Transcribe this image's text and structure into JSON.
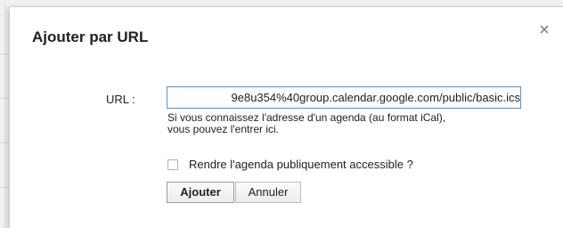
{
  "dialog": {
    "title": "Ajouter par URL",
    "close_icon": "close-icon"
  },
  "url_field": {
    "label": "URL :",
    "value": "9e8u354%40group.calendar.google.com/public/basic.ics"
  },
  "hint": {
    "line1": "Si vous connaissez l'adresse d'un agenda (au format iCal),",
    "line2": "vous pouvez l'entrer ici."
  },
  "public_option": {
    "label": "Rendre l'agenda publiquement accessible ?",
    "checked": false
  },
  "buttons": {
    "add": "Ajouter",
    "cancel": "Annuler"
  },
  "colors": {
    "focus_border": "#4d90fe",
    "text": "#222222"
  }
}
